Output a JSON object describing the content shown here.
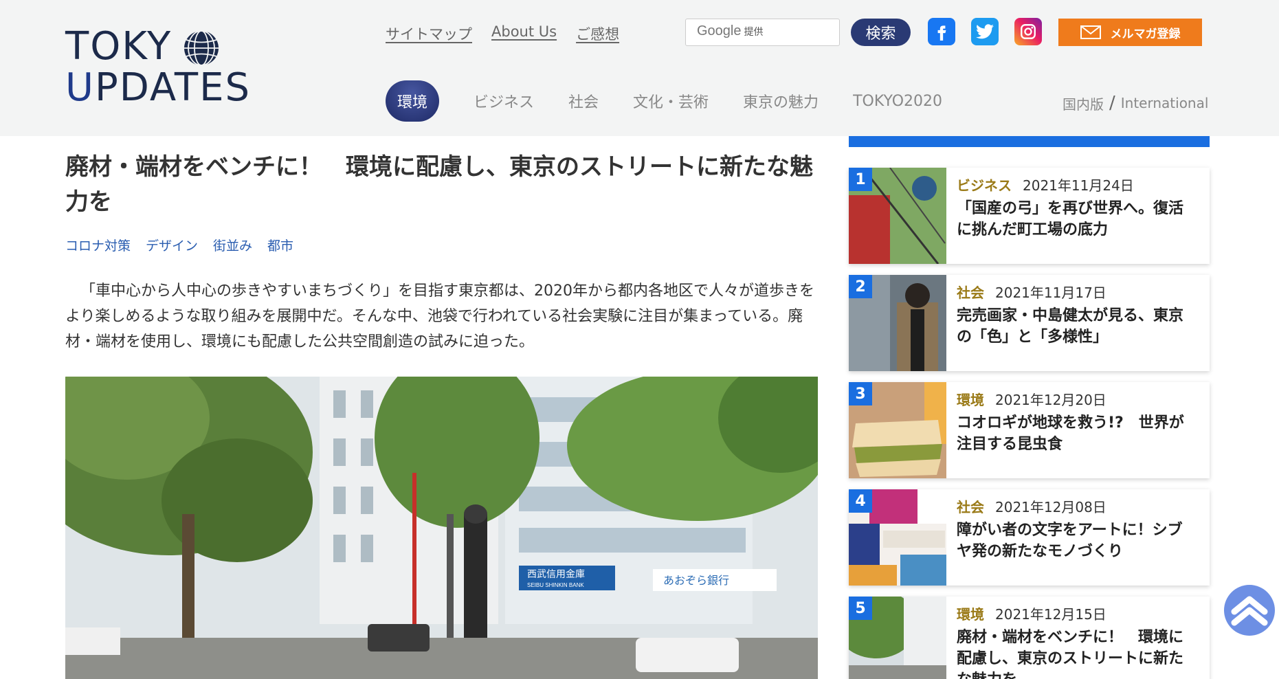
{
  "header": {
    "logo_line1": "TOKY",
    "logo_line2_u": "U",
    "logo_line2_rest": "PDATES",
    "top_links": [
      "サイトマップ",
      "About Us",
      "ご感想"
    ],
    "search": {
      "brand": "Google",
      "brand_sub": "提供",
      "button": "検索"
    },
    "social": [
      "facebook-icon",
      "twitter-icon",
      "instagram-icon"
    ],
    "newsletter_label": "メルマガ登録",
    "nav": [
      "環境",
      "ビジネス",
      "社会",
      "文化・芸術",
      "東京の魅力",
      "TOKYO2020"
    ],
    "nav_active": "環境",
    "lang": {
      "domestic": "国内版",
      "separator": "/",
      "international": "International"
    }
  },
  "article": {
    "title": "廃材・端材をベンチに！　環境に配慮し、東京のストリートに新たな魅力を",
    "tags": [
      "コロナ対策",
      "デザイン",
      "街並み",
      "都市"
    ],
    "lead": "「車中心から人中心の歩きやすいまちづくり」を目指す東京都は、2020年から都内各地区で人々が道歩きをより楽しめるような取り組みを展開中だ。そんな中、池袋で行われている社会実験に注目が集まっている。廃材・端材を使用し、環境にも配慮した公共空間創造の試みに迫った。",
    "hero_signs": [
      "西武信用金庫",
      "SEIBU SHINKIN BANK",
      "あおぞら銀行"
    ]
  },
  "ranking": [
    {
      "num": "1",
      "category": "ビジネス",
      "date": "2021年11月24日",
      "title": "「国産の弓」を再び世界へ。復活に挑んだ町工場の底力"
    },
    {
      "num": "2",
      "category": "社会",
      "date": "2021年11月17日",
      "title": "完売画家・中島健太が見る、東京の「色」と「多様性」"
    },
    {
      "num": "3",
      "category": "環境",
      "date": "2021年12月20日",
      "title": "コオロギが地球を救う!?　世界が注目する昆虫食"
    },
    {
      "num": "4",
      "category": "社会",
      "date": "2021年12月08日",
      "title": "障がい者の文字をアートに！シブヤ発の新たなモノづくり"
    },
    {
      "num": "5",
      "category": "環境",
      "date": "2021年12月15日",
      "title": "廃材・端材をベンチに！　環境に配慮し、東京のストリートに新たな魅力を"
    }
  ],
  "colors": {
    "accent_blue": "#1a6ee0",
    "nav_active": "#2a3a74",
    "newsletter": "#ef7b1c",
    "category_gold": "#9a7a17",
    "tag_blue": "#2a5db0"
  }
}
